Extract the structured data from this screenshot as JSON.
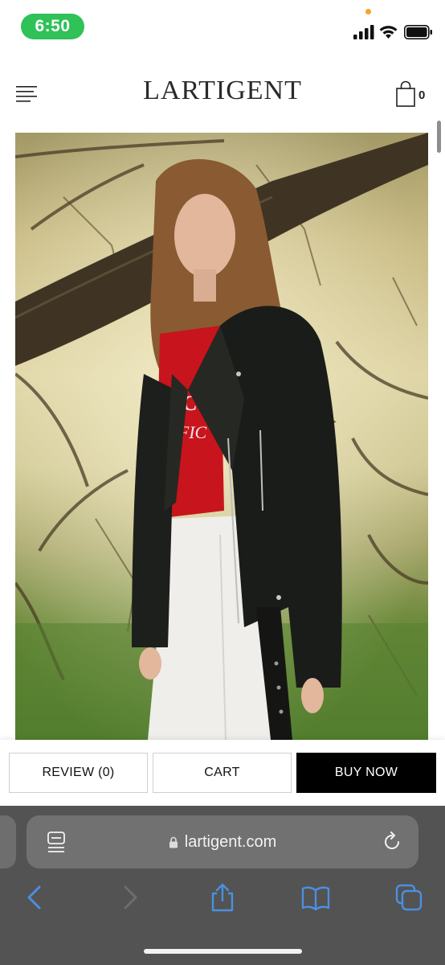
{
  "status_bar": {
    "time": "6:50",
    "time_pill_color": "#30c157",
    "icons": [
      "cellular-signal-icon",
      "wifi-icon",
      "battery-icon"
    ]
  },
  "header": {
    "brand": "LARTIGENT",
    "cart_count": "0",
    "icons": [
      "menu-icon",
      "shopping-bag-icon"
    ]
  },
  "hero": {
    "image": "model in black leather jacket, red graphic t-shirt and white jeans under a tree",
    "nav": [
      "chevron-up-icon",
      "chevron-down-icon"
    ]
  },
  "actions": {
    "review_label": "REVIEW (0)",
    "cart_label": "CART",
    "buy_label": "BUY NOW",
    "buy_bg": "#000000"
  },
  "browser": {
    "url": "lartigent.com",
    "accent": "#4a90e2",
    "icons": [
      "reader-icon",
      "lock-icon",
      "reload-icon",
      "back-icon",
      "forward-icon",
      "share-icon",
      "bookmarks-icon",
      "tabs-icon"
    ]
  }
}
